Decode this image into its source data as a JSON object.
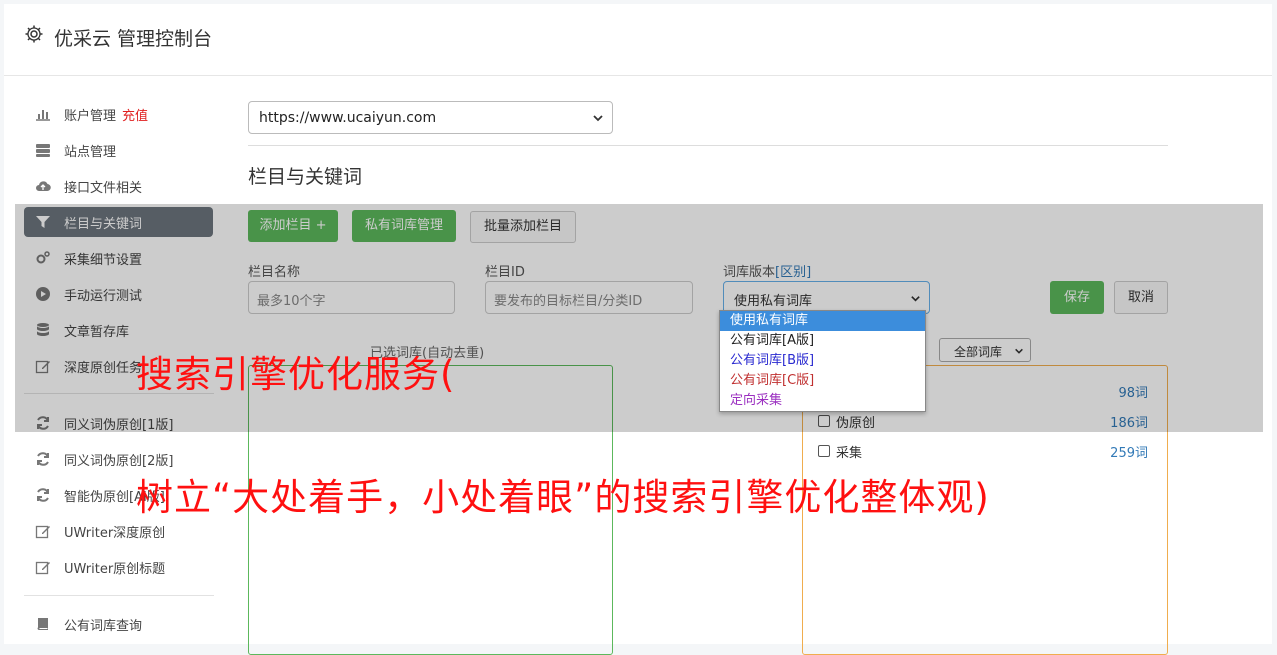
{
  "header": {
    "title": "优采云 管理控制台",
    "icon": "gear-icon"
  },
  "sidebar": {
    "items": [
      {
        "label": "账户管理",
        "badge": "充值",
        "icon": "bar-chart-icon"
      },
      {
        "label": "站点管理",
        "icon": "server-icon"
      },
      {
        "label": "接口文件相关",
        "icon": "cloud-upload-icon"
      },
      {
        "label": "栏目与关键词",
        "icon": "filter-icon",
        "active": true
      },
      {
        "label": "采集细节设置",
        "icon": "cogs-icon"
      },
      {
        "label": "手动运行测试",
        "icon": "play-circle-icon"
      },
      {
        "label": "文章暂存库",
        "icon": "database-icon"
      },
      {
        "label": "深度原创任务",
        "icon": "edit-icon"
      },
      {
        "label": "同义词伪原创[1版]",
        "icon": "refresh-icon"
      },
      {
        "label": "同义词伪原创[2版]",
        "icon": "refresh-icon"
      },
      {
        "label": "智能伪原创[AI版]",
        "icon": "refresh-icon"
      },
      {
        "label": "UWriter深度原创",
        "icon": "edit-icon"
      },
      {
        "label": "UWriter原创标题",
        "icon": "edit-icon"
      },
      {
        "label": "公有词库查询",
        "icon": "book-icon"
      }
    ]
  },
  "site_select": {
    "value": "https://www.ucaiyun.com"
  },
  "section_title": "栏目与关键词",
  "toolbar": {
    "add_column": "添加栏目 +",
    "private_lib": "私有词库管理",
    "batch_add": "批量添加栏目"
  },
  "form": {
    "column_name_label": "栏目名称",
    "column_name_placeholder": "最多10个字",
    "column_id_label": "栏目ID",
    "column_id_placeholder": "要发布的目标栏目/分类ID",
    "lib_version_label": "词库版本",
    "lib_version_link": "[区别]",
    "lib_version_value": "使用私有词库",
    "save": "保存",
    "cancel": "取消"
  },
  "selected_lib_label": "已选词库(自动去重)",
  "lib_filter": {
    "value": "全部词库"
  },
  "categories": [
    {
      "name": "伪原创",
      "count": "186词"
    },
    {
      "name": "采集",
      "count": "259词"
    }
  ],
  "first_count": "98词",
  "dropdown": {
    "options": [
      {
        "label": "使用私有词库",
        "color": "#ffffff",
        "selected": true
      },
      {
        "label": "公有词库[A版]",
        "color": "#222222"
      },
      {
        "label": "公有词库[B版]",
        "color": "#2a2ad0"
      },
      {
        "label": "公有词库[C版]",
        "color": "#c03030"
      },
      {
        "label": "定向采集",
        "color": "#9b30c0"
      }
    ]
  },
  "watermark": {
    "line1": "搜索引擎优化服务(",
    "line2": "树立“大处着手，小处着眼”的搜索引擎优化整体观)"
  },
  "colors": {
    "accent_green": "#5cb85c",
    "watermark_red": "#ff1010",
    "active_nav": "#6c757d"
  }
}
